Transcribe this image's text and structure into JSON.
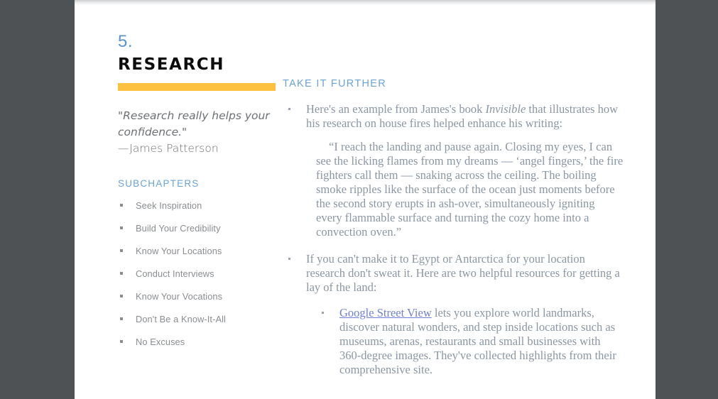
{
  "colors": {
    "backdrop": "#4e5255",
    "page": "#ffffff",
    "accent_bar": "#fdc03f",
    "heading_blue": "#6aa3d5",
    "number_blue": "#5b93cf",
    "body_text": "#8b96a3",
    "sidebar_text": "#8a8d90",
    "quote_text": "#6d7073",
    "link": "#6f7fd6",
    "title_black": "#0c0c0c"
  },
  "chapter": {
    "number": "5.",
    "title": "RESEARCH"
  },
  "quote": {
    "text": "\"Research really helps your confidence.\"",
    "attribution": "—James Patterson"
  },
  "sidebar": {
    "subchapters_heading": "SUBCHAPTERS",
    "items": [
      {
        "label": "Seek Inspiration"
      },
      {
        "label": "Build Your Credibility"
      },
      {
        "label": "Know Your Locations"
      },
      {
        "label": "Conduct Interviews"
      },
      {
        "label": "Know Your Vocations"
      },
      {
        "label": "Don't Be a Know-It-All"
      },
      {
        "label": "No Excuses"
      }
    ]
  },
  "main": {
    "section_heading": "TAKE IT FURTHER",
    "bullet_1": {
      "before_italic": "Here's an example from James's book ",
      "italic": "Invisible",
      "after_italic": " that illustrates how his research on house fires helped enhance his writing:"
    },
    "pullquote": "“I reach the landing and pause again. Closing my eyes, I can see the licking flames from my dreams — ‘angel  fingers,’ the fire fighters call them — snaking across the ceiling. The boiling smoke ripples like the surface of the ocean just moments before the second story erupts in  ash-over, simultaneously igniting every flammable surface and turning the cozy home into a convection oven.”",
    "bullet_2": "If you can't make it to Egypt or Antarctica for your location research don't sweat it. Here are two helpful resources for getting a lay of the land:",
    "sub_bullet_1": {
      "link_text": "Google Street View",
      "rest": " lets you explore world landmarks, discover natural wonders, and step inside locations such as museums, arenas, restaurants and small businesses with 360-degree images. They've collected highlights from their comprehensive site."
    }
  }
}
